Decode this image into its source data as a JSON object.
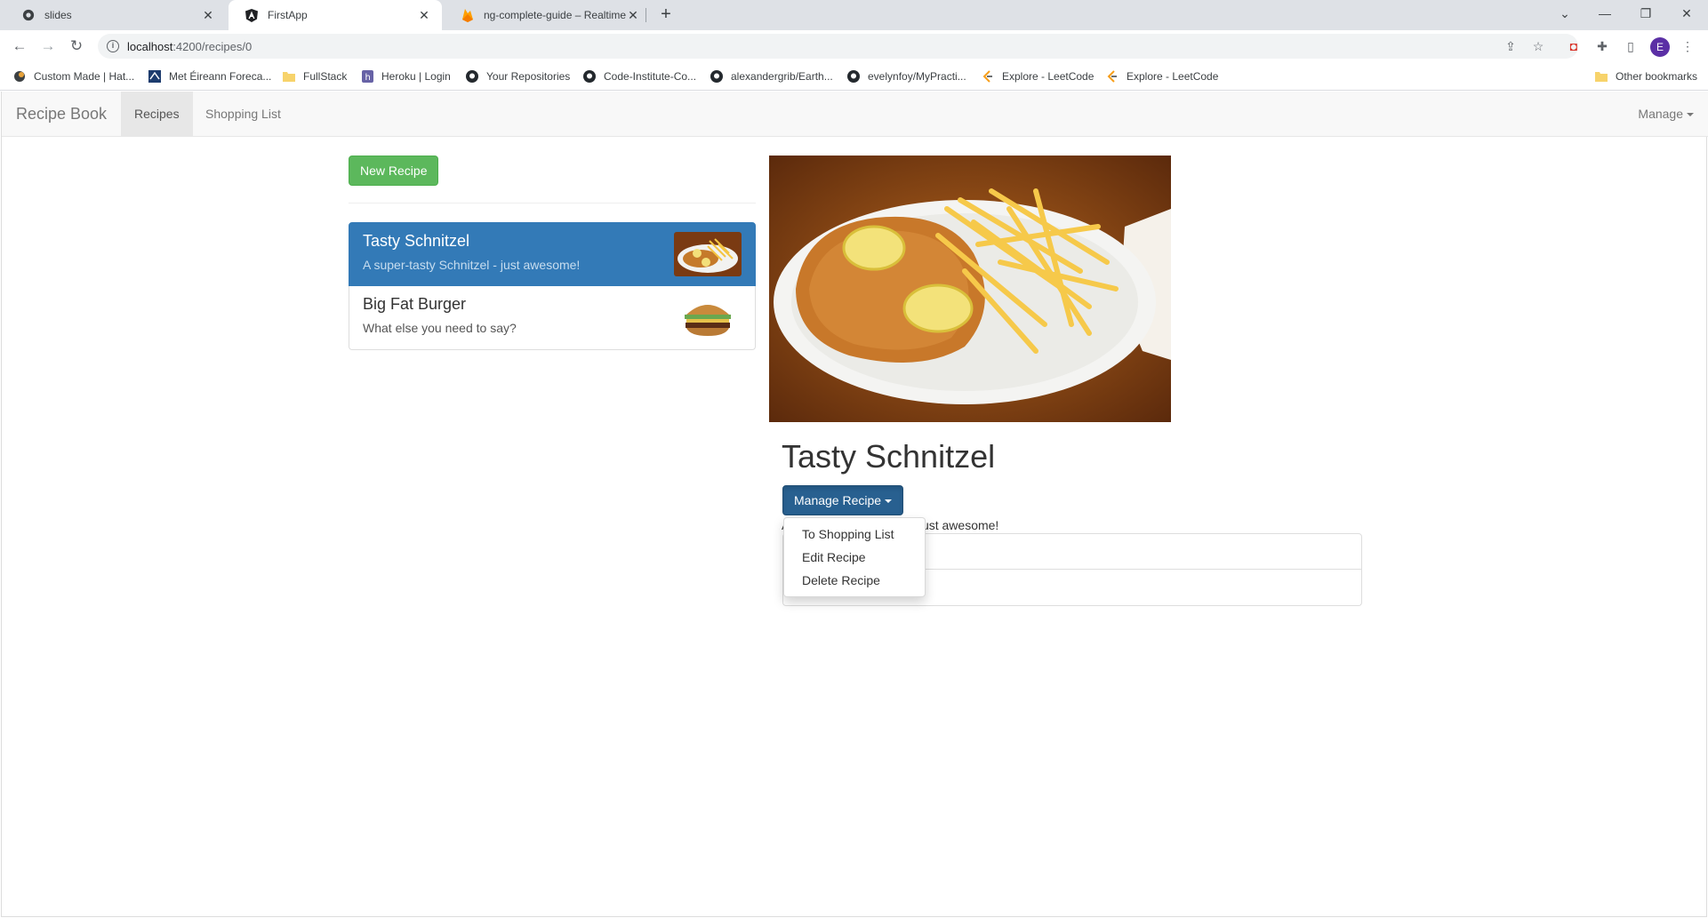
{
  "browser": {
    "tabs": [
      {
        "title": "slides",
        "icon": "github-icon"
      },
      {
        "title": "FirstApp",
        "icon": "angular-icon"
      },
      {
        "title": "ng-complete-guide – Realtime D",
        "icon": "firebase-icon"
      }
    ],
    "url_host": "localhost",
    "url_rest": ":4200/recipes/0",
    "profile_initial": "E",
    "bookmarks": [
      {
        "label": "Custom Made | Hat...",
        "icon": "site-icon"
      },
      {
        "label": "Met Éireann Foreca...",
        "icon": "met-eireann-icon"
      },
      {
        "label": "FullStack",
        "icon": "folder-icon"
      },
      {
        "label": "Heroku | Login",
        "icon": "heroku-icon"
      },
      {
        "label": "Your Repositories",
        "icon": "github-icon"
      },
      {
        "label": "Code-Institute-Co...",
        "icon": "github-icon"
      },
      {
        "label": "alexandergrib/Earth...",
        "icon": "github-icon"
      },
      {
        "label": "evelynfoy/MyPracti...",
        "icon": "github-icon"
      },
      {
        "label": "Explore - LeetCode",
        "icon": "leetcode-icon"
      },
      {
        "label": "Explore - LeetCode",
        "icon": "leetcode-icon"
      }
    ],
    "other_bookmarks": "Other bookmarks"
  },
  "app": {
    "brand": "Recipe Book",
    "nav": {
      "recipes": "Recipes",
      "shopping_list": "Shopping List",
      "manage": "Manage"
    },
    "new_recipe_button": "New Recipe",
    "recipes": [
      {
        "name": "Tasty Schnitzel",
        "description": "A super-tasty Schnitzel - just awesome!",
        "active": true
      },
      {
        "name": "Big Fat Burger",
        "description": "What else you need to say?",
        "active": false
      }
    ],
    "detail": {
      "title": "Tasty Schnitzel",
      "manage_button": "Manage Recipe",
      "description": "A super-tasty Schnitzel - just awesome!",
      "dropdown": [
        "To Shopping List",
        "Edit Recipe",
        "Delete Recipe"
      ]
    },
    "colors": {
      "active_item": "#337ab7",
      "success": "#5cb85c",
      "primary_pressed": "#286090"
    }
  }
}
